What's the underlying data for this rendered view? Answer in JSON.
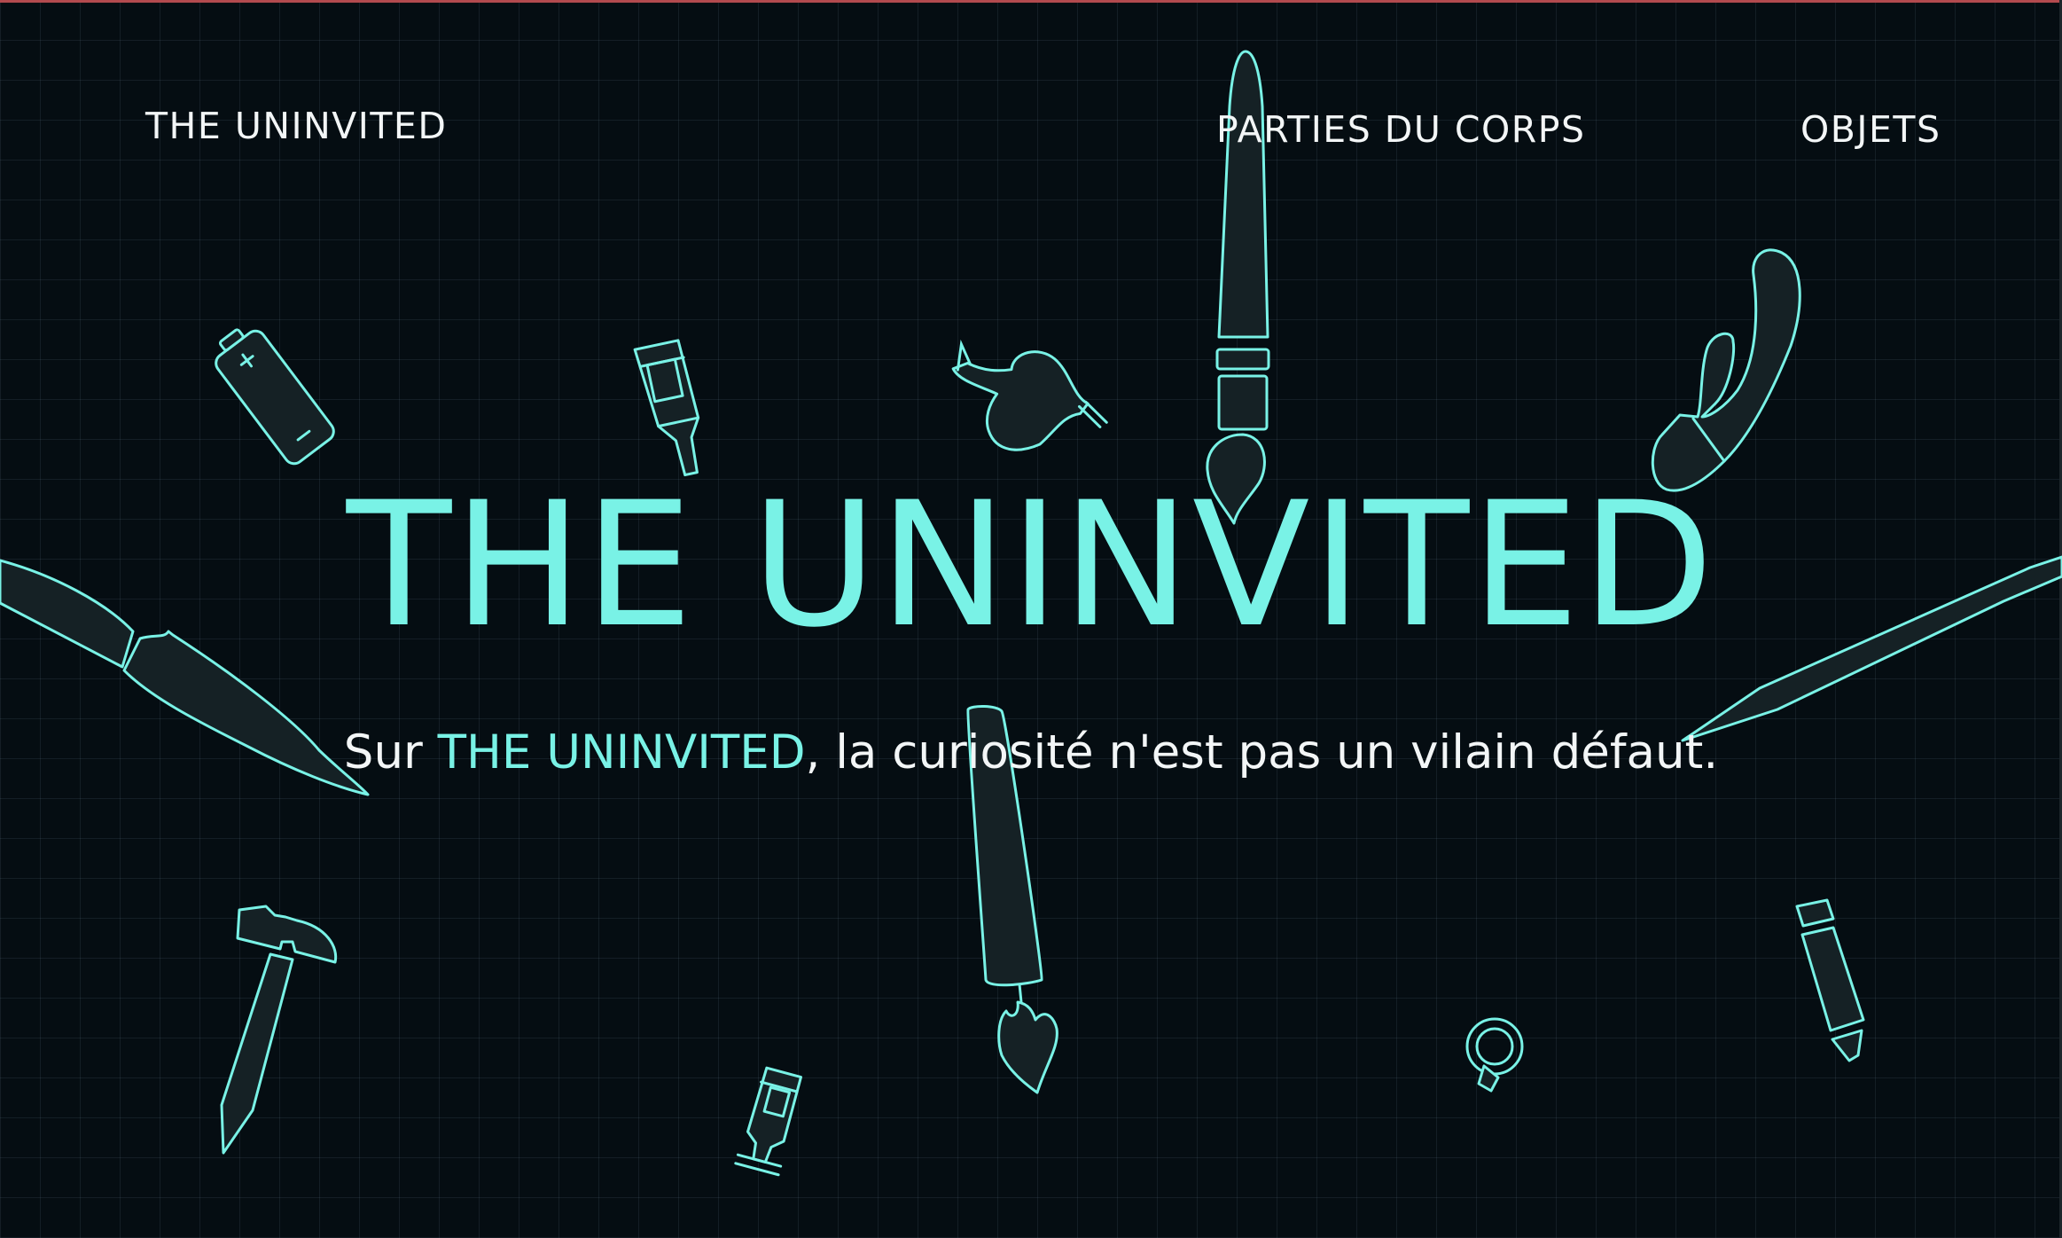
{
  "header": {
    "brand": "THE UNINVITED",
    "nav": [
      {
        "label": "PARTIES DU CORPS"
      },
      {
        "label": "OBJETS"
      }
    ]
  },
  "hero": {
    "title": "THE UNINVITED",
    "subtitle_before": "Sur ",
    "subtitle_highlight": "THE UNINVITED",
    "subtitle_after": ", la curiosité n'est pas un vilain défaut."
  },
  "colors": {
    "background": "#050d12",
    "accent": "#79f2e6",
    "text": "#f3f6f7"
  },
  "decorations": [
    "battery-icon",
    "bottle-icon",
    "vase-icon",
    "paintbrush-icon",
    "vibrator-icon",
    "knife-icon",
    "sword-icon",
    "hammer-icon",
    "flashlight-icon",
    "ring-icon",
    "pencil-icon",
    "small-bottle-icon"
  ]
}
